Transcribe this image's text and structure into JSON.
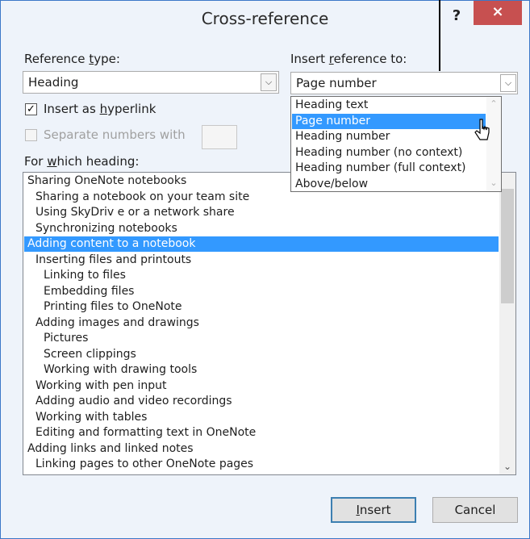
{
  "dialog": {
    "title": "Cross-reference",
    "help_label": "?",
    "close_label": "×"
  },
  "reference_type": {
    "label_pre": "Reference ",
    "label_key": "t",
    "label_post": "ype:",
    "value": "Heading"
  },
  "insert_reference": {
    "label_pre": "Insert ",
    "label_key": "r",
    "label_post": "eference to:",
    "value": "Page number",
    "options": [
      "Heading text",
      "Page number",
      "Heading number",
      "Heading number (no context)",
      "Heading number (full  context)",
      "Above/below"
    ],
    "highlighted_index": 1
  },
  "hyperlink": {
    "label_pre": "Insert as ",
    "label_key": "h",
    "label_post": "yperlink",
    "checked": true
  },
  "separate_numbers": {
    "label": "Separate numbers with",
    "checked": false,
    "enabled": false
  },
  "heading_list": {
    "label_pre": "For ",
    "label_key": "w",
    "label_post": "hich heading:",
    "selected_index": 4,
    "items": [
      {
        "text": "Sharing OneNote notebooks",
        "level": 0
      },
      {
        "text": "Sharing a notebook on your team site",
        "level": 1
      },
      {
        "text": "Using SkyDriv e or a network share",
        "level": 1
      },
      {
        "text": "Synchronizing notebooks",
        "level": 1
      },
      {
        "text": "Adding content to a notebook",
        "level": 0
      },
      {
        "text": "Inserting files and printouts",
        "level": 1
      },
      {
        "text": "Linking to files",
        "level": 2
      },
      {
        "text": "Embedding files",
        "level": 2
      },
      {
        "text": "Printing files to OneNote",
        "level": 2
      },
      {
        "text": "Adding images and drawings",
        "level": 1
      },
      {
        "text": "Pictures",
        "level": 2
      },
      {
        "text": "Screen clippings",
        "level": 2
      },
      {
        "text": "Working with drawing tools",
        "level": 2
      },
      {
        "text": "Working with pen input",
        "level": 1
      },
      {
        "text": "Adding audio and video recordings",
        "level": 1
      },
      {
        "text": "Working with tables",
        "level": 1
      },
      {
        "text": "Editing and formatting text in OneNote",
        "level": 1
      },
      {
        "text": "Adding links and linked notes",
        "level": 0
      },
      {
        "text": "Linking pages to other OneNote pages",
        "level": 1
      }
    ]
  },
  "buttons": {
    "insert_key": "I",
    "insert_rest": "nsert",
    "cancel_label": "Cancel"
  }
}
